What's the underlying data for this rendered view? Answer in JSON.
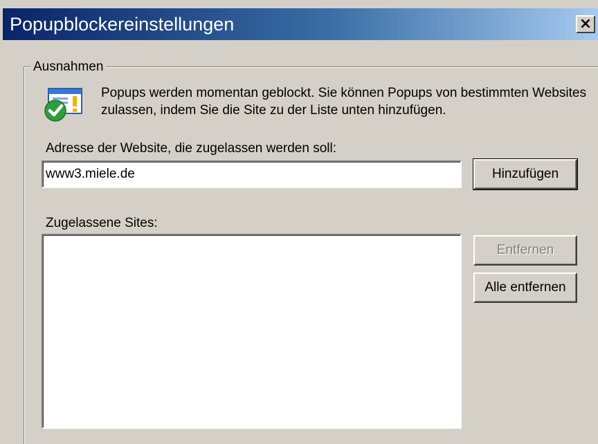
{
  "window": {
    "title": "Popupblockereinstellungen",
    "close_glyph": "×"
  },
  "exceptions": {
    "legend": "Ausnahmen",
    "icon": "popup-shield-check-icon",
    "info_text": "Popups werden momentan geblockt. Sie können Popups von bestimmten Websites zulassen, indem Sie die Site zu der Liste unten hinzufügen.",
    "address_label": "Adresse der Website, die zugelassen werden soll:",
    "address_value": "www3.miele.de",
    "add_button": "Hinzufügen",
    "allowed_label": "Zugelassene Sites:",
    "allowed_sites": [],
    "remove_button": "Entfernen",
    "remove_all_button": "Alle entfernen"
  },
  "colors": {
    "title_gradient_start": "#0a246a",
    "title_gradient_end": "#a6caf0",
    "dialog_face": "#d4d0c8"
  }
}
